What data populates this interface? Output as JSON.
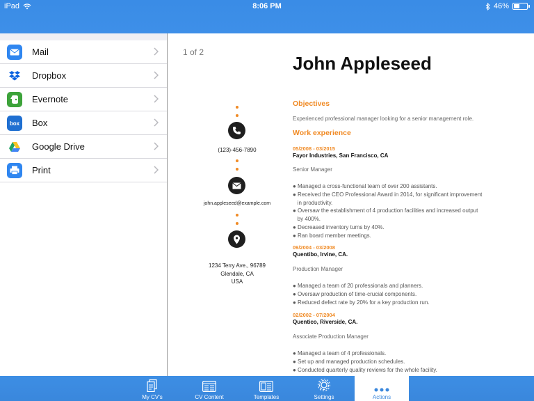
{
  "status_bar": {
    "device": "iPad",
    "time": "8:06 PM",
    "battery": "46%",
    "battery_level": 0.46
  },
  "share_menu": {
    "items": [
      {
        "label": "Mail",
        "icon": "mail-icon",
        "color": "#2f86f0"
      },
      {
        "label": "Dropbox",
        "icon": "dropbox-icon",
        "color": "#0a62e0"
      },
      {
        "label": "Evernote",
        "icon": "evernote-icon",
        "color": "#3da33a"
      },
      {
        "label": "Box",
        "icon": "box-icon",
        "color": "#1f6fd1"
      },
      {
        "label": "Google Drive",
        "icon": "google-drive-icon",
        "color": "#1fa463"
      },
      {
        "label": "Print",
        "icon": "print-icon",
        "color": "#2f86f0"
      }
    ]
  },
  "document": {
    "page_indicator": "1 of 2",
    "name": "John Appleseed",
    "phone": "(123)-456-7890",
    "email": "john.appleseed@example.com",
    "address_line1": "1234 Terry Ave., 96789",
    "address_line2": "Glendale, CA",
    "address_line3": "USA",
    "objectives_title": "Objectives",
    "objectives_text": "Experienced professional manager looking for a senior management role.",
    "work_title": "Work experience",
    "jobs": [
      {
        "dates": "05/2008 - 03/2015",
        "company": "Fayor Industries, San Francisco, CA",
        "role": "Senior Manager",
        "bullets": [
          "● Managed a cross-functional team of over 200 assistants.",
          "● Received the CEO Professional Award in 2014, for significant improvement",
          "   in productivity.",
          "● Oversaw the establishment of 4 production facilities and increased output",
          "   by 400%.",
          "● Decreased inventory turns by 40%.",
          "● Ran board member meetings."
        ]
      },
      {
        "dates": "09/2004 - 03/2008",
        "company": "Quentibo, Irvine, CA.",
        "role": "Production Manager",
        "bullets": [
          "● Managed a team of 20 professionals and planners.",
          "● Oversaw production of time-crucial components.",
          "● Reduced defect rate by 20% for a key production run."
        ]
      },
      {
        "dates": "02/2002 - 07/2004",
        "company": "Quentico, Riverside, CA.",
        "role": "Associate Production Manager",
        "bullets": [
          "● Managed a team of 4 professionals.",
          "● Set up and managed production schedules.",
          "● Conducted quarterly quality reviews for the whole facility."
        ]
      }
    ]
  },
  "tab_bar": {
    "tabs": [
      {
        "label": "My CV's",
        "icon": "my-cvs-icon"
      },
      {
        "label": "CV Content",
        "icon": "cv-content-icon"
      },
      {
        "label": "Templates",
        "icon": "templates-icon"
      },
      {
        "label": "Settings",
        "icon": "settings-icon"
      },
      {
        "label": "Actions",
        "icon": "actions-icon",
        "active": true
      }
    ]
  },
  "colors": {
    "accent": "#f08a24",
    "brand_blue": "#3a87dc"
  }
}
